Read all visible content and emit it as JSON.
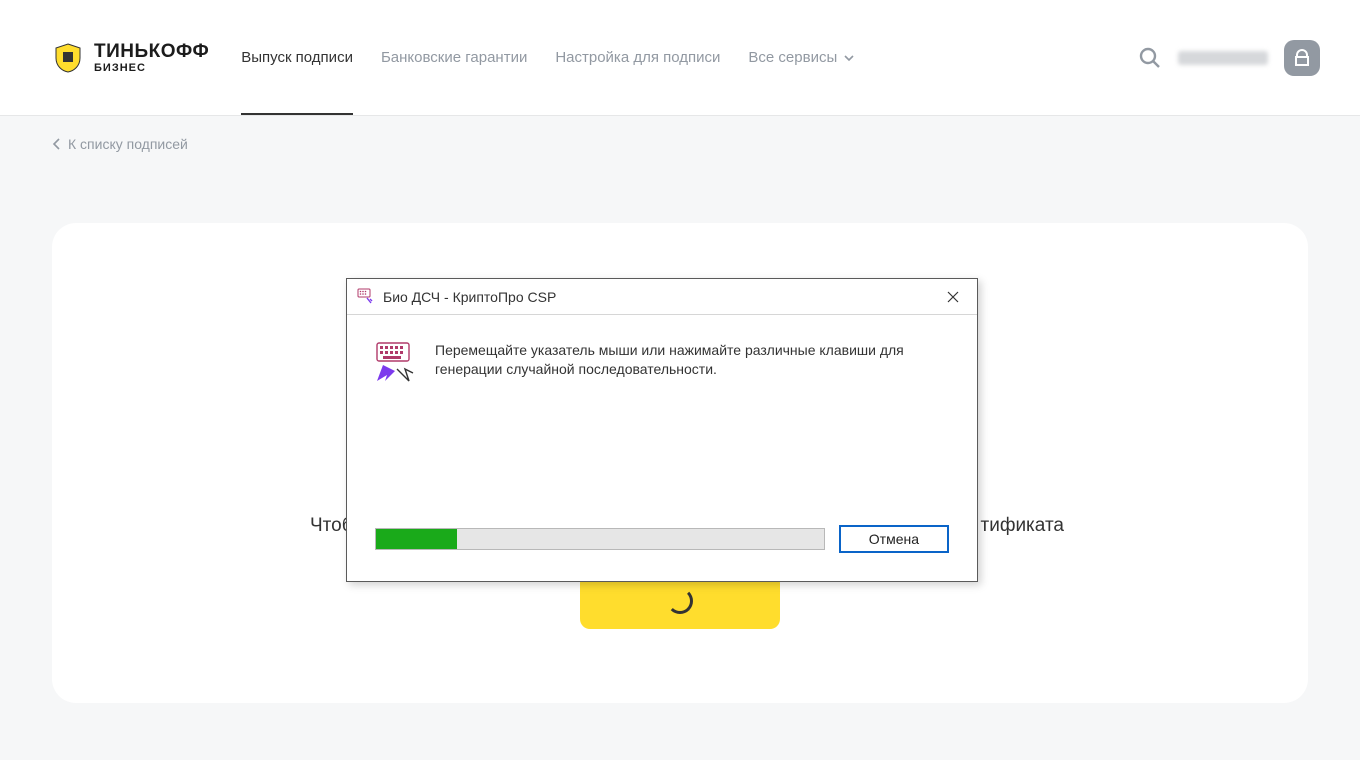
{
  "brand": {
    "main": "ТИНЬКОФФ",
    "sub": "БИЗНЕС"
  },
  "nav": {
    "items": [
      {
        "label": "Выпуск подписи",
        "active": true
      },
      {
        "label": "Банковские гарантии",
        "active": false
      },
      {
        "label": "Настройка для подписи",
        "active": false
      },
      {
        "label": "Все сервисы",
        "active": false,
        "dropdown": true
      }
    ]
  },
  "back_link": "К списку подписей",
  "card": {
    "partial_text_left": "Чтоб",
    "partial_text_right": "тификата"
  },
  "modal": {
    "title": "Био ДСЧ - КриптоПро CSP",
    "message": "Перемещайте указатель мыши или нажимайте различные клавиши для генерации случайной последовательности.",
    "progress_percent": 18,
    "cancel_label": "Отмена"
  },
  "colors": {
    "accent_yellow": "#ffdd2d",
    "progress_green": "#1aaa1a",
    "win_blue": "#0a64c8"
  }
}
